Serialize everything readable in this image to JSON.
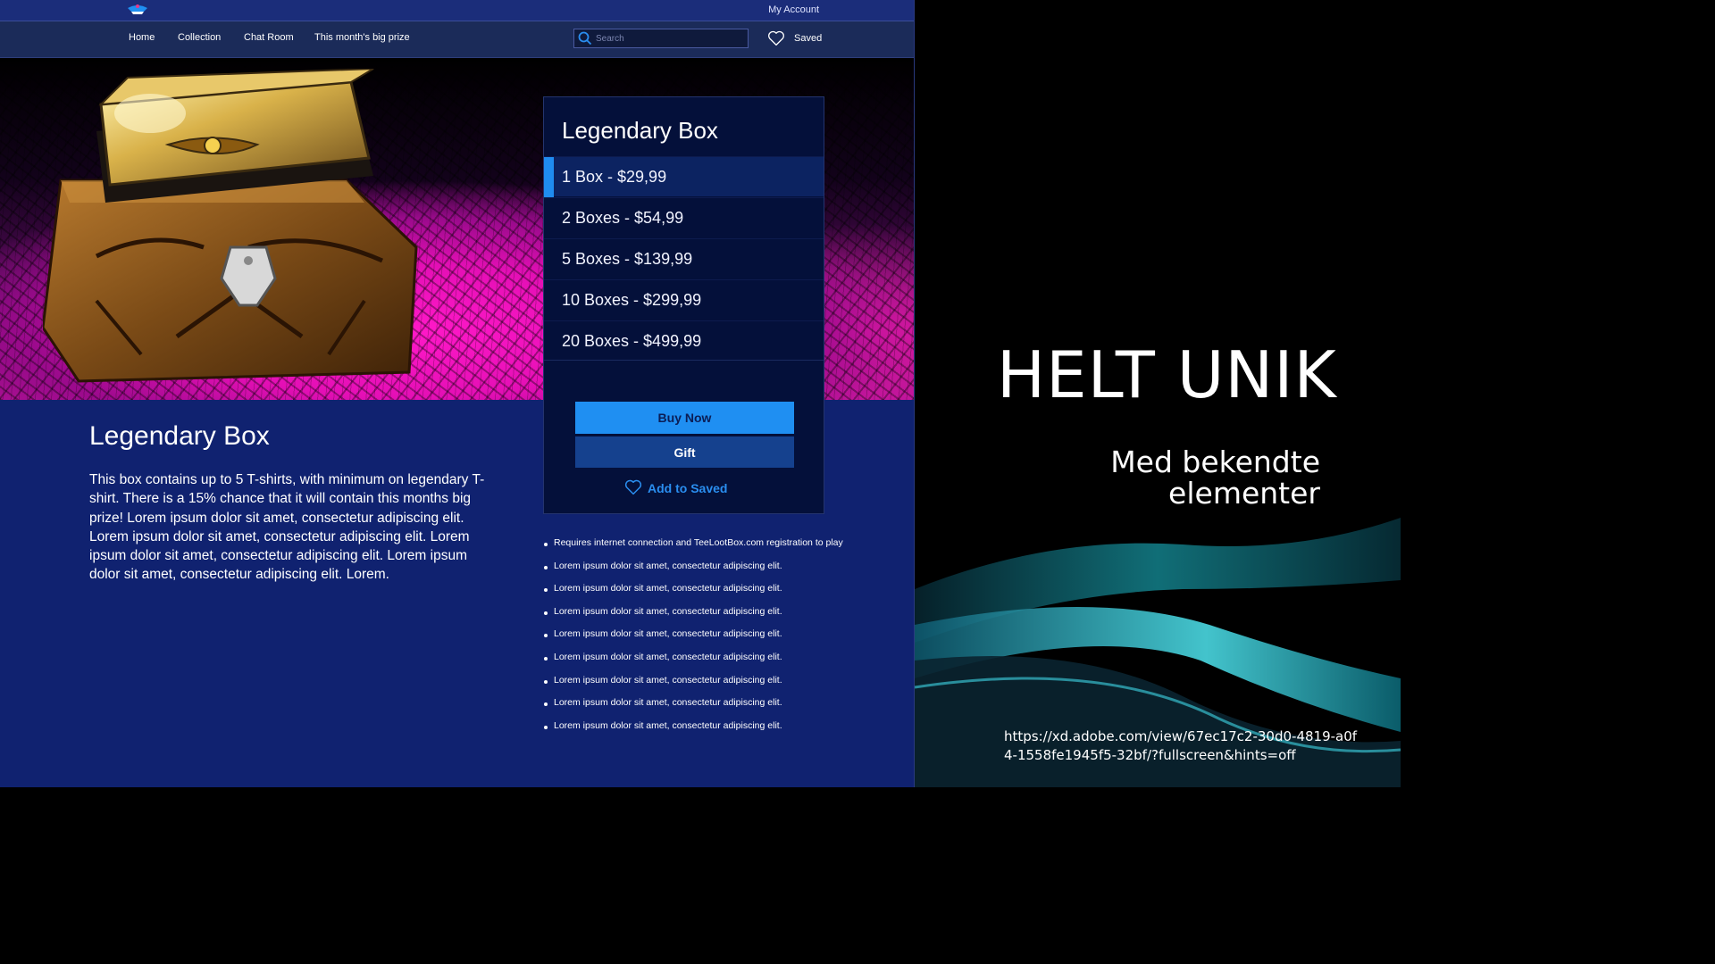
{
  "topbar": {
    "my_account": "My Account"
  },
  "nav": {
    "items": [
      "Home",
      "Collection",
      "Chat Room",
      "This month's big prize"
    ],
    "search_placeholder": "Search",
    "saved_label": "Saved"
  },
  "panel": {
    "title": "Legendary Box",
    "options": [
      {
        "label": "1 Box - $29,99",
        "selected": true
      },
      {
        "label": "2 Boxes - $54,99",
        "selected": false
      },
      {
        "label": "5 Boxes - $139,99",
        "selected": false
      },
      {
        "label": "10 Boxes - $299,99",
        "selected": false
      },
      {
        "label": "20 Boxes - $499,99",
        "selected": false
      }
    ],
    "buy_now": "Buy Now",
    "gift": "Gift",
    "add_to_saved": "Add to Saved"
  },
  "description": {
    "title": "Legendary Box",
    "body": "This box contains up to 5 T-shirts, with minimum on legendary T-shirt. There is a 15% chance that it will contain this months big prize! Lorem ipsum dolor sit amet, consectetur adipiscing elit. Lorem ipsum dolor sit amet, consectetur adipiscing elit. Lorem ipsum dolor sit amet, consectetur adipiscing elit. Lorem ipsum dolor sit amet, consectetur adipiscing elit. Lorem."
  },
  "bullets": [
    "Requires internet connection and TeeLootBox.com registration to play",
    "Lorem ipsum dolor sit amet, consectetur adipiscing elit.",
    "Lorem ipsum dolor sit amet, consectetur adipiscing elit.",
    "Lorem ipsum dolor sit amet, consectetur adipiscing elit.",
    "Lorem ipsum dolor sit amet, consectetur adipiscing elit.",
    "Lorem ipsum dolor sit amet, consectetur adipiscing elit.",
    "Lorem ipsum dolor sit amet, consectetur adipiscing elit.",
    "Lorem ipsum dolor sit amet, consectetur adipiscing elit.",
    "Lorem ipsum dolor sit amet, consectetur adipiscing elit."
  ],
  "slide": {
    "title": "HELT UNIK",
    "subtitle_line1": "Med bekendte",
    "subtitle_line2": "elementer",
    "url": "https://xd.adobe.com/view/67ec17c2-30d0-4819-a0f4-1558fe1945f5-32bf/?fullscreen&hints=off"
  },
  "icons": {
    "logo": "logo-icon",
    "search": "search-icon",
    "heart": "heart-icon",
    "hero_image": "treasure-chest-image"
  },
  "colors": {
    "page_bg": "#102270",
    "topbar_bg": "#1b2d7a",
    "navbar_bg": "#1b2b59",
    "panel_bg": "#04103a",
    "accent_blue": "#1f8ff2",
    "gift_blue": "#15418e",
    "hero_magenta": "#ff19c8"
  }
}
